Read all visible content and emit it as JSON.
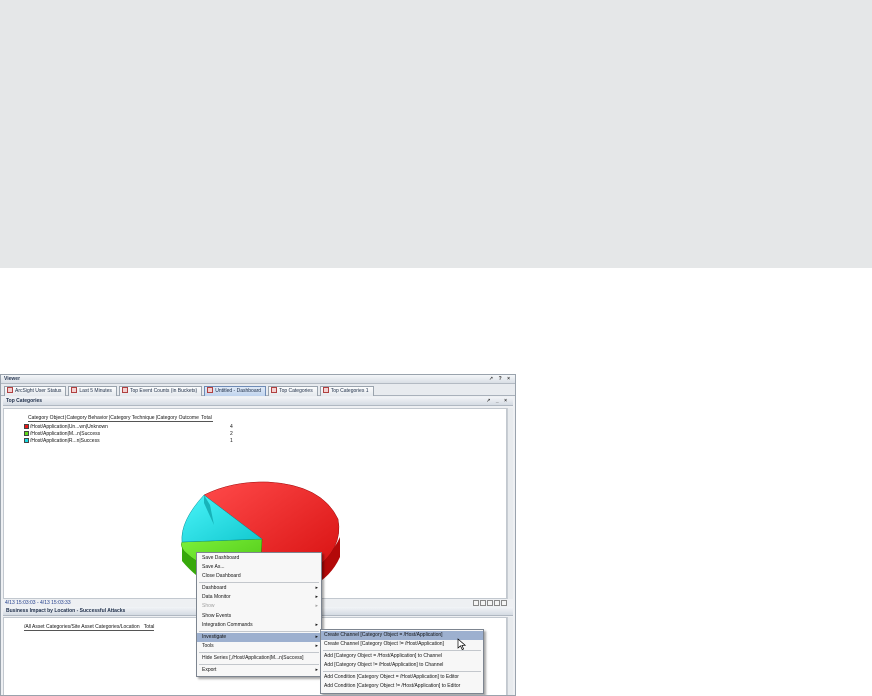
{
  "window": {
    "title": "Viewer",
    "controls": "↗ ? ×"
  },
  "tabs": [
    {
      "label": "ArcSight User Status",
      "active": false
    },
    {
      "label": "Last 5 Minutes",
      "active": false
    },
    {
      "label": "Top Event Counts (in Buckets)",
      "active": false
    },
    {
      "label": "Untitled - Dashboard",
      "active": true
    },
    {
      "label": "Top Categories",
      "active": false
    },
    {
      "label": "Top Categories 1",
      "active": false
    }
  ],
  "top_panel": {
    "title": "Top Categories",
    "controls": "↗ _ ×",
    "columns": [
      "Category Object",
      "Category Behavior",
      "Category Technique",
      "Category Outcome",
      "Total"
    ],
    "rows": [
      {
        "label": "/Host/Application|Un...wn|Unknown",
        "value": "4",
        "color": "#e81a1a"
      },
      {
        "label": "/Host/Application|M...n|Success",
        "value": "2",
        "color": "#5fd91a"
      },
      {
        "label": "/Host/Application|R...n|Success",
        "value": "1",
        "color": "#1ad9e0"
      }
    ],
    "status": "4/13 15:03:03 - 4/13 15:03:33"
  },
  "bottom_panel": {
    "title": "Business Impact by Location - Successful Attacks",
    "columns": [
      "/All Asset Categories/Site Asset Categories/Location",
      "Total"
    ]
  },
  "context_menu": {
    "items": [
      {
        "label": "Save Dashboard",
        "submenu": false,
        "disabled": false
      },
      {
        "label": "Save As...",
        "submenu": false,
        "disabled": false
      },
      {
        "label": "Close Dashboard",
        "submenu": false,
        "disabled": false
      },
      {
        "label": "Dashboard",
        "submenu": true,
        "disabled": false
      },
      {
        "label": "Data Monitor",
        "submenu": true,
        "disabled": false
      },
      {
        "label": "Show",
        "submenu": true,
        "disabled": true
      },
      {
        "label": "Show Events",
        "submenu": false,
        "disabled": false
      },
      {
        "label": "Integration Commands",
        "submenu": true,
        "disabled": false
      },
      {
        "label": "Investigate",
        "submenu": true,
        "disabled": false,
        "selected": true
      },
      {
        "label": "Tools",
        "submenu": true,
        "disabled": false
      },
      {
        "label": "Hide Series [,/Host/Application|M...n|Success]",
        "submenu": false,
        "disabled": false
      },
      {
        "label": "Export",
        "submenu": true,
        "disabled": false
      }
    ]
  },
  "investigate_submenu": {
    "items": [
      {
        "label": "Create Channel [Category Object = /Host/Application]",
        "selected": true
      },
      {
        "label": "Create Channel [Category Object != /Host/Application]",
        "selected": false
      },
      {
        "label": "Add [Category Object = /Host/Application] to Channel",
        "selected": false
      },
      {
        "label": "Add [Category Object != /Host/Application] to Channel",
        "selected": false
      },
      {
        "label": "Add Condition [Category Object = /Host/Application] to Editor",
        "selected": false
      },
      {
        "label": "Add Condition [Category Object != /Host/Application] to Editor",
        "selected": false
      }
    ]
  }
}
